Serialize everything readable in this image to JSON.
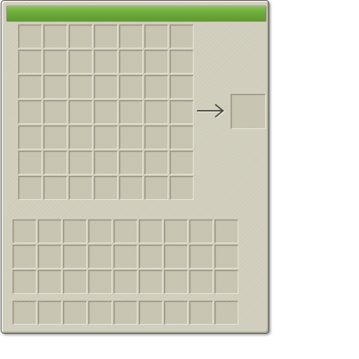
{
  "window": {
    "type": "crafting-interface"
  },
  "progress": {
    "value": 1.0,
    "color": "#6db43e"
  },
  "crafting_grid": {
    "rows": 7,
    "columns": 7,
    "slots": []
  },
  "output_slot": {
    "item": null
  },
  "arrow": {
    "icon": "right-arrow-icon"
  },
  "inventory": {
    "rows": 3,
    "columns": 9,
    "slots": []
  },
  "hotbar": {
    "columns": 9,
    "slots": []
  },
  "colors": {
    "panel_background": "#d2cfbe",
    "slot_background": "#c9c6b3",
    "panel_border": "#4e4c44"
  }
}
